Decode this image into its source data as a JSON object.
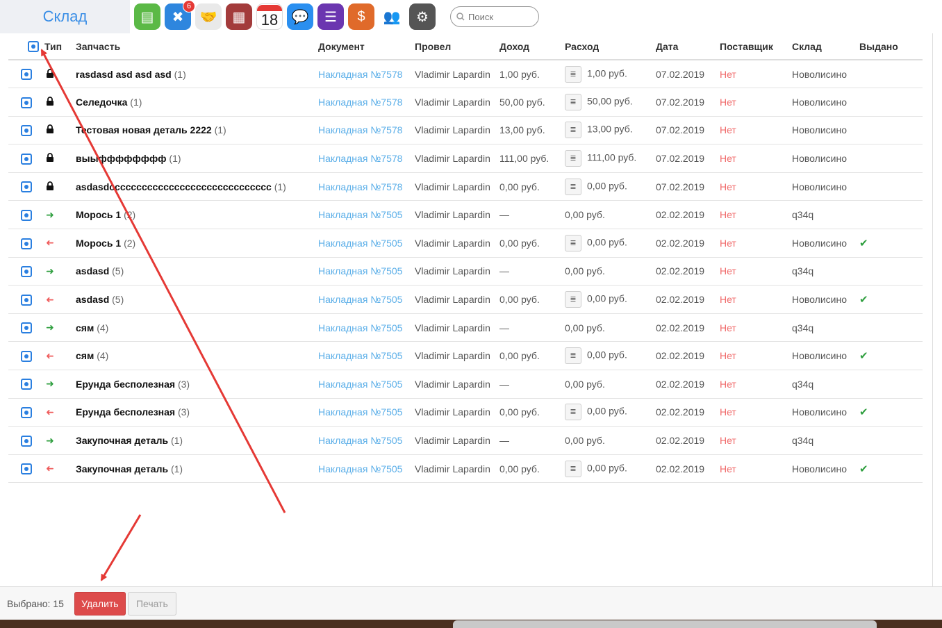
{
  "brand": "Склад",
  "apps": [
    {
      "icon": "contacts-icon",
      "color": "#5bb946"
    },
    {
      "icon": "tools-icon",
      "color": "#2e86de",
      "badge": "6"
    },
    {
      "icon": "handshake-icon",
      "color": "#e9e9e9"
    },
    {
      "icon": "warehouse-icon",
      "color": "#a33b3b"
    },
    {
      "icon": "calendar-icon",
      "color": "#ffffff",
      "day": "18"
    },
    {
      "icon": "chat-icon",
      "color": "#2a8ff0"
    },
    {
      "icon": "settings-sliders-icon",
      "color": "#6b36b0"
    },
    {
      "icon": "dollar-icon",
      "color": "#e06a2a"
    },
    {
      "icon": "people-icon",
      "color": "#ffffff"
    },
    {
      "icon": "gear-icon",
      "color": "#555555"
    }
  ],
  "search": {
    "placeholder": "Поиск"
  },
  "columns": [
    "Тип",
    "Запчасть",
    "Документ",
    "Провел",
    "Доход",
    "Расход",
    "Дата",
    "Поставщик",
    "Склад",
    "Выдано"
  ],
  "rows": [
    {
      "type": "lock",
      "part": "rasdasd asd asd asd",
      "qty": "(1)",
      "doc": "Накладная №7578",
      "by": "Vladimir Lapardin",
      "income": "1,00 руб.",
      "expense": "1,00 руб.",
      "expense_btn": true,
      "date": "07.02.2019",
      "supplier": "Нет",
      "store": "Новолисино",
      "issued": ""
    },
    {
      "type": "lock",
      "part": "Селедочка",
      "qty": "(1)",
      "doc": "Накладная №7578",
      "by": "Vladimir Lapardin",
      "income": "50,00 руб.",
      "expense": "50,00 руб.",
      "expense_btn": true,
      "date": "07.02.2019",
      "supplier": "Нет",
      "store": "Новолисино",
      "issued": ""
    },
    {
      "type": "lock",
      "part": "Тестовая новая деталь 2222",
      "qty": "(1)",
      "doc": "Накладная №7578",
      "by": "Vladimir Lapardin",
      "income": "13,00 руб.",
      "expense": "13,00 руб.",
      "expense_btn": true,
      "date": "07.02.2019",
      "supplier": "Нет",
      "store": "Новолисино",
      "issued": ""
    },
    {
      "type": "lock",
      "part": "выыфффффффф",
      "qty": "(1)",
      "doc": "Накладная №7578",
      "by": "Vladimir Lapardin",
      "income": "111,00 руб.",
      "expense": "111,00 руб.",
      "expense_btn": true,
      "date": "07.02.2019",
      "supplier": "Нет",
      "store": "Новолисино",
      "issued": ""
    },
    {
      "type": "lock",
      "part": "asdasdcccccccccccccccccccccccccccccc",
      "qty": "(1)",
      "doc": "Накладная №7578",
      "by": "Vladimir Lapardin",
      "income": "0,00 руб.",
      "expense": "0,00 руб.",
      "expense_btn": true,
      "date": "07.02.2019",
      "supplier": "Нет",
      "store": "Новолисино",
      "issued": ""
    },
    {
      "type": "in",
      "part": "Морось 1",
      "qty": "(2)",
      "doc": "Накладная №7505",
      "by": "Vladimir Lapardin",
      "income": "—",
      "expense": "0,00 руб.",
      "expense_btn": false,
      "date": "02.02.2019",
      "supplier": "Нет",
      "store": "q34q",
      "issued": ""
    },
    {
      "type": "out",
      "part": "Морось 1",
      "qty": "(2)",
      "doc": "Накладная №7505",
      "by": "Vladimir Lapardin",
      "income": "0,00 руб.",
      "expense": "0,00 руб.",
      "expense_btn": true,
      "date": "02.02.2019",
      "supplier": "Нет",
      "store": "Новолисино",
      "issued": "✔"
    },
    {
      "type": "in",
      "part": "asdasd",
      "qty": "(5)",
      "doc": "Накладная №7505",
      "by": "Vladimir Lapardin",
      "income": "—",
      "expense": "0,00 руб.",
      "expense_btn": false,
      "date": "02.02.2019",
      "supplier": "Нет",
      "store": "q34q",
      "issued": ""
    },
    {
      "type": "out",
      "part": "asdasd",
      "qty": "(5)",
      "doc": "Накладная №7505",
      "by": "Vladimir Lapardin",
      "income": "0,00 руб.",
      "expense": "0,00 руб.",
      "expense_btn": true,
      "date": "02.02.2019",
      "supplier": "Нет",
      "store": "Новолисино",
      "issued": "✔"
    },
    {
      "type": "in",
      "part": "сям",
      "qty": "(4)",
      "doc": "Накладная №7505",
      "by": "Vladimir Lapardin",
      "income": "—",
      "expense": "0,00 руб.",
      "expense_btn": false,
      "date": "02.02.2019",
      "supplier": "Нет",
      "store": "q34q",
      "issued": ""
    },
    {
      "type": "out",
      "part": "сям",
      "qty": "(4)",
      "doc": "Накладная №7505",
      "by": "Vladimir Lapardin",
      "income": "0,00 руб.",
      "expense": "0,00 руб.",
      "expense_btn": true,
      "date": "02.02.2019",
      "supplier": "Нет",
      "store": "Новолисино",
      "issued": "✔"
    },
    {
      "type": "in",
      "part": "Ерунда бесполезная",
      "qty": "(3)",
      "doc": "Накладная №7505",
      "by": "Vladimir Lapardin",
      "income": "—",
      "expense": "0,00 руб.",
      "expense_btn": false,
      "date": "02.02.2019",
      "supplier": "Нет",
      "store": "q34q",
      "issued": ""
    },
    {
      "type": "out",
      "part": "Ерунда бесполезная",
      "qty": "(3)",
      "doc": "Накладная №7505",
      "by": "Vladimir Lapardin",
      "income": "0,00 руб.",
      "expense": "0,00 руб.",
      "expense_btn": true,
      "date": "02.02.2019",
      "supplier": "Нет",
      "store": "Новолисино",
      "issued": "✔"
    },
    {
      "type": "in",
      "part": "Закупочная деталь",
      "qty": "(1)",
      "doc": "Накладная №7505",
      "by": "Vladimir Lapardin",
      "income": "—",
      "expense": "0,00 руб.",
      "expense_btn": false,
      "date": "02.02.2019",
      "supplier": "Нет",
      "store": "q34q",
      "issued": ""
    },
    {
      "type": "out",
      "part": "Закупочная деталь",
      "qty": "(1)",
      "doc": "Накладная №7505",
      "by": "Vladimir Lapardin",
      "income": "0,00 руб.",
      "expense": "0,00 руб.",
      "expense_btn": true,
      "date": "02.02.2019",
      "supplier": "Нет",
      "store": "Новолисино",
      "issued": "✔"
    }
  ],
  "footer": {
    "selected": "Выбрано: 15",
    "delete_label": "Удалить",
    "print_label": "Печать"
  },
  "annotation_color": "#e53935"
}
